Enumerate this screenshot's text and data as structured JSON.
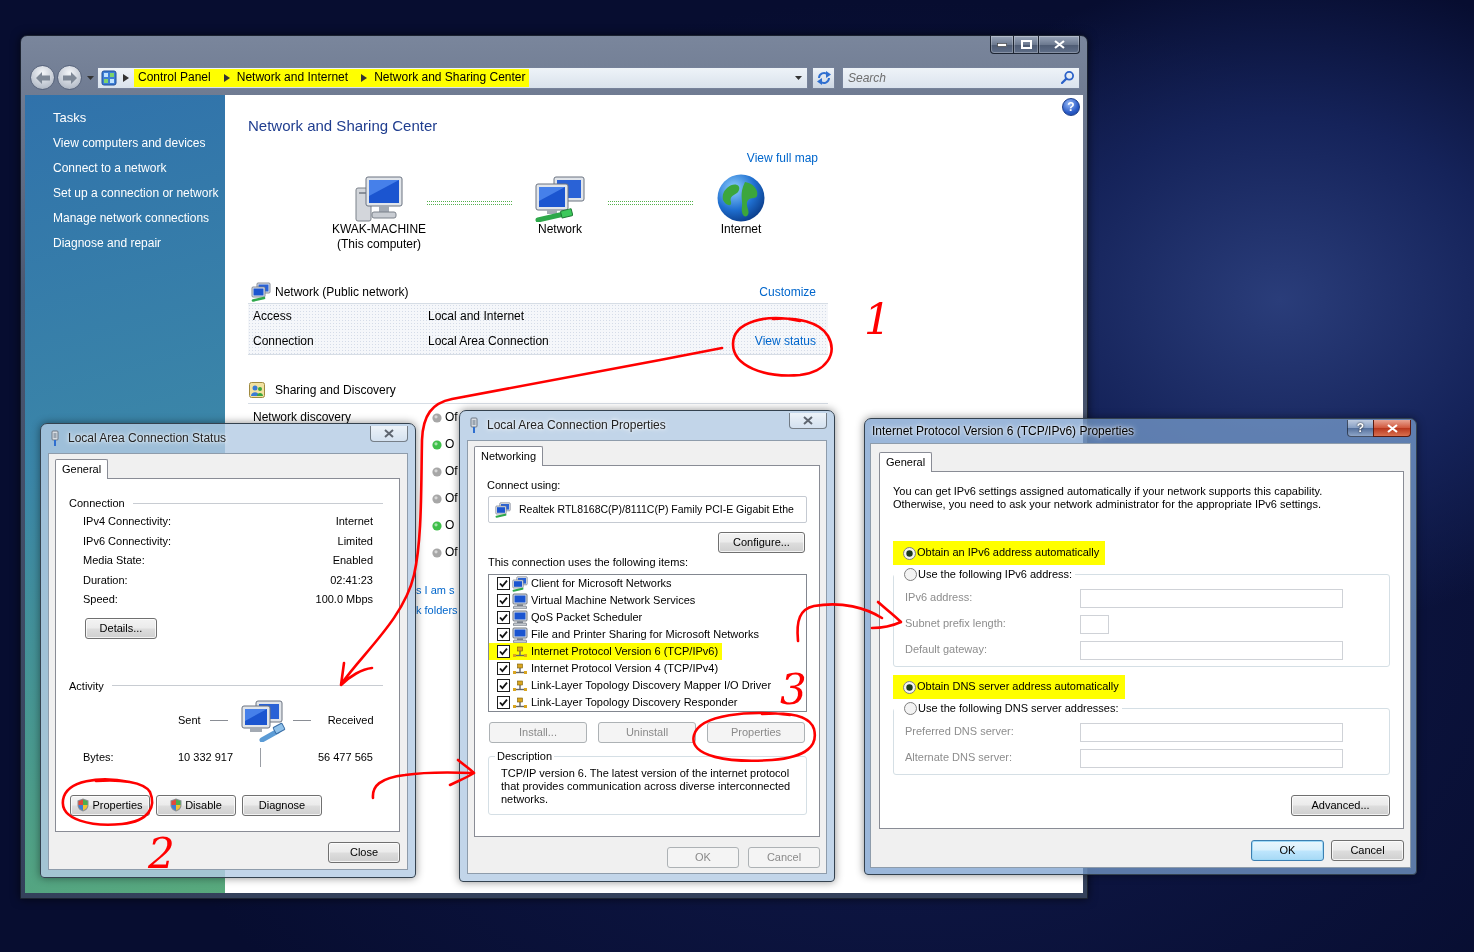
{
  "explorer": {
    "address": {
      "crumbs": [
        {
          "label": "Control Panel",
          "highlighted": true
        },
        {
          "label": "Network and Internet",
          "highlighted": true
        },
        {
          "label": "Network and Sharing Center",
          "highlighted": true
        }
      ]
    },
    "search": {
      "placeholder": "Search"
    },
    "sidebar": {
      "title": "Tasks",
      "items": [
        "View computers and devices",
        "Connect to a network",
        "Set up a connection or network",
        "Manage network connections",
        "Diagnose and repair"
      ]
    },
    "help_button": "?",
    "heading": "Network and Sharing Center",
    "view_full_map": "View full map",
    "map": [
      {
        "kind": "computer",
        "label": "KWAK-MACHINE",
        "sublabel": "(This computer)"
      },
      {
        "kind": "network",
        "label": "Network"
      },
      {
        "kind": "internet",
        "label": "Internet"
      }
    ],
    "network": {
      "title": "Network (Public network)",
      "link": "Customize",
      "rows": [
        {
          "label": "Access",
          "value": "Local and Internet"
        },
        {
          "label": "Connection",
          "value": "Local Area Connection",
          "link": "View status"
        }
      ]
    },
    "sharing": {
      "title": "Sharing and Discovery",
      "rows": [
        {
          "label": "Network discovery",
          "status": "Of",
          "on": false
        },
        {
          "status": "O",
          "on": true
        },
        {
          "status": "Of",
          "on": false
        },
        {
          "status": "Of",
          "on": false
        },
        {
          "status": "O",
          "on": true
        },
        {
          "status": "Of",
          "on": false
        }
      ],
      "links": [
        "s I am s",
        "k folders"
      ]
    }
  },
  "status_dialog": {
    "title": "Local Area Connection Status",
    "tabs": [
      {
        "label": "General",
        "selected": true
      }
    ],
    "connection": {
      "title": "Connection",
      "rows": [
        {
          "label": "IPv4 Connectivity:",
          "value": "Internet"
        },
        {
          "label": "IPv6 Connectivity:",
          "value": "Limited"
        },
        {
          "label": "Media State:",
          "value": "Enabled"
        },
        {
          "label": "Duration:",
          "value": "02:41:23"
        },
        {
          "label": "Speed:",
          "value": "100.0 Mbps"
        }
      ]
    },
    "details_button": "Details...",
    "activity": {
      "title": "Activity",
      "sent": "Sent",
      "received": "Received",
      "bytes_label": "Bytes:",
      "bytes_sent": "10 332 917",
      "bytes_received": "56 477 565"
    },
    "buttons": [
      {
        "label": "Properties",
        "shield": true
      },
      {
        "label": "Disable",
        "shield": true
      },
      {
        "label": "Diagnose",
        "shield": false
      }
    ],
    "close_button": "Close"
  },
  "properties_dialog": {
    "title": "Local Area Connection Properties",
    "tabs": [
      {
        "label": "Networking",
        "selected": true
      }
    ],
    "connect_using_label": "Connect using:",
    "adapter": "Realtek RTL8168C(P)/8111C(P) Family PCI-E Gigabit Ethe",
    "configure_button": "Configure...",
    "items_label": "This connection uses the following items:",
    "items": [
      {
        "kind": "client",
        "label": "Client for Microsoft Networks",
        "checked": true,
        "highlighted": false
      },
      {
        "kind": "service",
        "label": "Virtual Machine Network Services",
        "checked": true,
        "highlighted": false
      },
      {
        "kind": "service",
        "label": "QoS Packet Scheduler",
        "checked": true,
        "highlighted": false
      },
      {
        "kind": "service",
        "label": "File and Printer Sharing for Microsoft Networks",
        "checked": true,
        "highlighted": false
      },
      {
        "kind": "protocol",
        "label": "Internet Protocol Version 6 (TCP/IPv6)",
        "checked": true,
        "highlighted": true
      },
      {
        "kind": "protocol",
        "label": "Internet Protocol Version 4 (TCP/IPv4)",
        "checked": true,
        "highlighted": false
      },
      {
        "kind": "protocol",
        "label": "Link-Layer Topology Discovery Mapper I/O Driver",
        "checked": true,
        "highlighted": false
      },
      {
        "kind": "protocol",
        "label": "Link-Layer Topology Discovery Responder",
        "checked": true,
        "highlighted": false
      }
    ],
    "item_buttons": [
      {
        "label": "Install...",
        "disabled": true
      },
      {
        "label": "Uninstall",
        "disabled": true
      },
      {
        "label": "Properties",
        "disabled": true
      }
    ],
    "description": {
      "title": "Description",
      "text": "TCP/IP version 6. The latest version of the internet protocol that provides communication across diverse interconnected networks."
    },
    "footer_buttons": [
      {
        "label": "OK",
        "disabled": true
      },
      {
        "label": "Cancel",
        "disabled": true
      }
    ]
  },
  "ipv6_dialog": {
    "title": "Internet Protocol Version 6 (TCP/IPv6) Properties",
    "help_button": "?",
    "tabs": [
      {
        "label": "General",
        "selected": true
      }
    ],
    "intro": "You can get IPv6 settings assigned automatically if your network supports this capability.\nOtherwise, you need to ask your network administrator for the appropriate IPv6 settings.",
    "address_options": [
      {
        "label": "Obtain an IPv6 address automatically",
        "selected": true,
        "highlighted": true
      },
      {
        "label": "Use the following IPv6 address:",
        "selected": false,
        "highlighted": false
      }
    ],
    "address_fields": [
      {
        "label": "IPv6 address:",
        "kind": "wide",
        "disabled": true
      },
      {
        "label": "Subnet prefix length:",
        "kind": "short",
        "disabled": true
      },
      {
        "label": "Default gateway:",
        "kind": "wide",
        "disabled": true
      }
    ],
    "dns_options": [
      {
        "label": "Obtain DNS server address automatically",
        "selected": true,
        "highlighted": true
      },
      {
        "label": "Use the following DNS server addresses:",
        "selected": false,
        "highlighted": false
      }
    ],
    "dns_fields": [
      {
        "label": "Preferred DNS server:",
        "kind": "wide",
        "disabled": true
      },
      {
        "label": "Alternate DNS server:",
        "kind": "wide",
        "disabled": true
      }
    ],
    "advanced_button": "Advanced...",
    "footer_buttons": [
      {
        "label": "OK",
        "default": true
      },
      {
        "label": "Cancel",
        "default": false
      }
    ]
  },
  "annotations": [
    {
      "number": "1"
    },
    {
      "number": "2"
    },
    {
      "number": "3"
    }
  ]
}
